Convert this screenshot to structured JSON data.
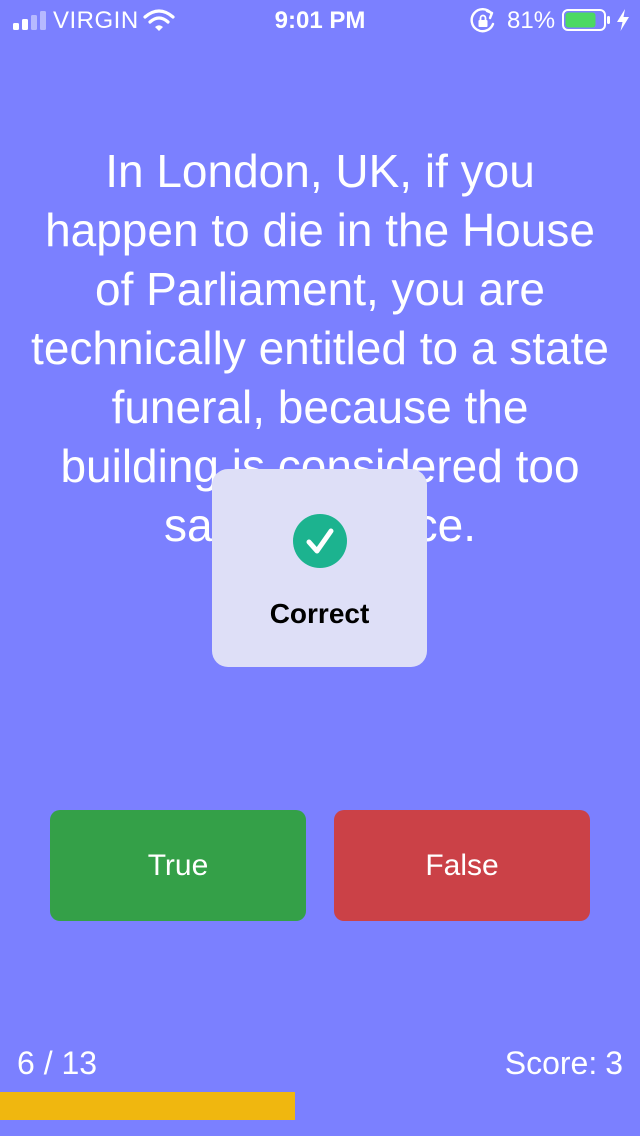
{
  "status_bar": {
    "carrier": "VIRGIN",
    "time": "9:01 PM",
    "battery_percent": "81%",
    "battery_level": 0.81,
    "icons": [
      "signal-icon",
      "wifi-icon",
      "orientation-lock-icon",
      "battery-icon",
      "charging-bolt-icon"
    ]
  },
  "quiz": {
    "question": "In London, UK, if you happen to die in the House of Parliament, you are technically entitled to a state funeral, because the building is considered too sacred a place.",
    "true_label": "True",
    "false_label": "False"
  },
  "feedback": {
    "label": "Correct",
    "icon": "checkmark-circle-icon"
  },
  "footer": {
    "progress_text": "6 / 13",
    "score_label": "Score:",
    "score_value": "3",
    "progress_fraction": 0.4615
  },
  "colors": {
    "background": "#7b80ff",
    "true_button": "#34a048",
    "false_button": "#cb4147",
    "progress_bar": "#f0b70f",
    "check_circle": "#1cb38f",
    "battery_fill": "#4cd964"
  }
}
